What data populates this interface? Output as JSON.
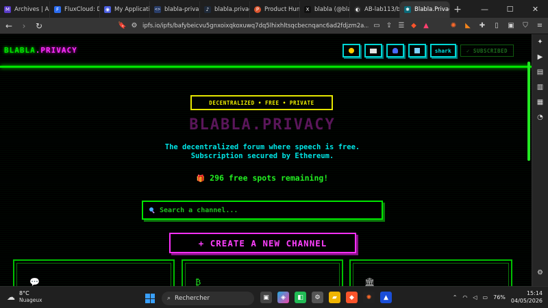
{
  "browser": {
    "tabs": [
      {
        "label": "Archives | AB",
        "color": "#5a3cc8",
        "glyph": "M"
      },
      {
        "label": "FluxCloud: D",
        "color": "#2b6cf0",
        "glyph": "F"
      },
      {
        "label": "My Applicatio",
        "color": "#4a5ee0",
        "glyph": "◉"
      },
      {
        "label": "blabla-privac",
        "color": "#2a3e6a",
        "glyph": "<>"
      },
      {
        "label": "blabla.privac",
        "color": "#1f2a3a",
        "glyph": "♪"
      },
      {
        "label": "Product Hun",
        "color": "#da552f",
        "glyph": "P"
      },
      {
        "label": "blabla (@bla",
        "color": "#111111",
        "glyph": "X"
      },
      {
        "label": "AB-lab113/bl",
        "color": "#333333",
        "glyph": "◐"
      },
      {
        "label": "Blabla.Privac",
        "color": "#0b6a7a",
        "glyph": "✱"
      }
    ],
    "new_tab": "+",
    "window_controls": {
      "minimize": "—",
      "maximize": "☐",
      "close": "✕"
    },
    "url": "ipfs.io/ipfs/bafybeicvu5gnxoixqkoxuwq7dq5lhixhltsqcbecnqanc6ad2fdjzm2a..."
  },
  "site": {
    "logo_main": "BLABLA",
    "logo_dot": ".",
    "logo_priv": "PRIVACY",
    "username": "shark",
    "subscribed_label": "✓ SUBSCRIBED",
    "header_icon_colors": [
      "#ffcc00",
      "#e0e0e0",
      "#4a6aff",
      "#80d0ff"
    ]
  },
  "hero": {
    "tagline": "DECENTRALIZED • FREE • PRIVATE",
    "title": "BLABLA.PRIVACY",
    "subtitle_1": "The decentralized forum where speech is free.",
    "subtitle_2": "Subscription secured by Ethereum.",
    "spots_icon": "🎁",
    "spots_text": "296 free spots remaining!"
  },
  "search": {
    "placeholder": "Search a channel..."
  },
  "create_button": "+ CREATE A NEW CHANNEL",
  "cards": [
    {
      "icon": "💬"
    },
    {
      "icon": "₿"
    },
    {
      "icon": "🏛"
    }
  ],
  "taskbar": {
    "temperature": "8°C",
    "condition": "Nuageux",
    "search_label": "Rechercher",
    "battery": "76%",
    "time": "15:14",
    "date": "04/05/2026"
  }
}
